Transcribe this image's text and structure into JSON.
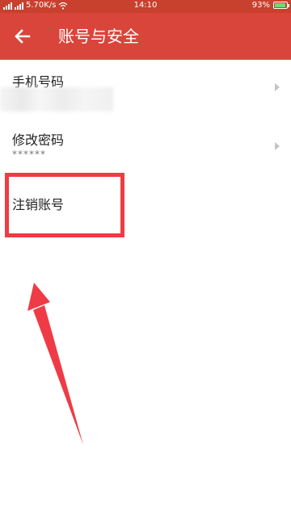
{
  "status_bar": {
    "network_speed": "5.70K/s",
    "time": "14:10",
    "battery_percent": "93%",
    "battery_level": 0.93
  },
  "app_bar": {
    "title": "账号与安全",
    "back_icon": "arrow-left-icon"
  },
  "settings": [
    {
      "label": "手机号码",
      "value_hidden": true
    },
    {
      "label": "修改密码",
      "value": "******"
    },
    {
      "label": "注销账号"
    }
  ],
  "annotation": {
    "color": "#ef3b45"
  }
}
